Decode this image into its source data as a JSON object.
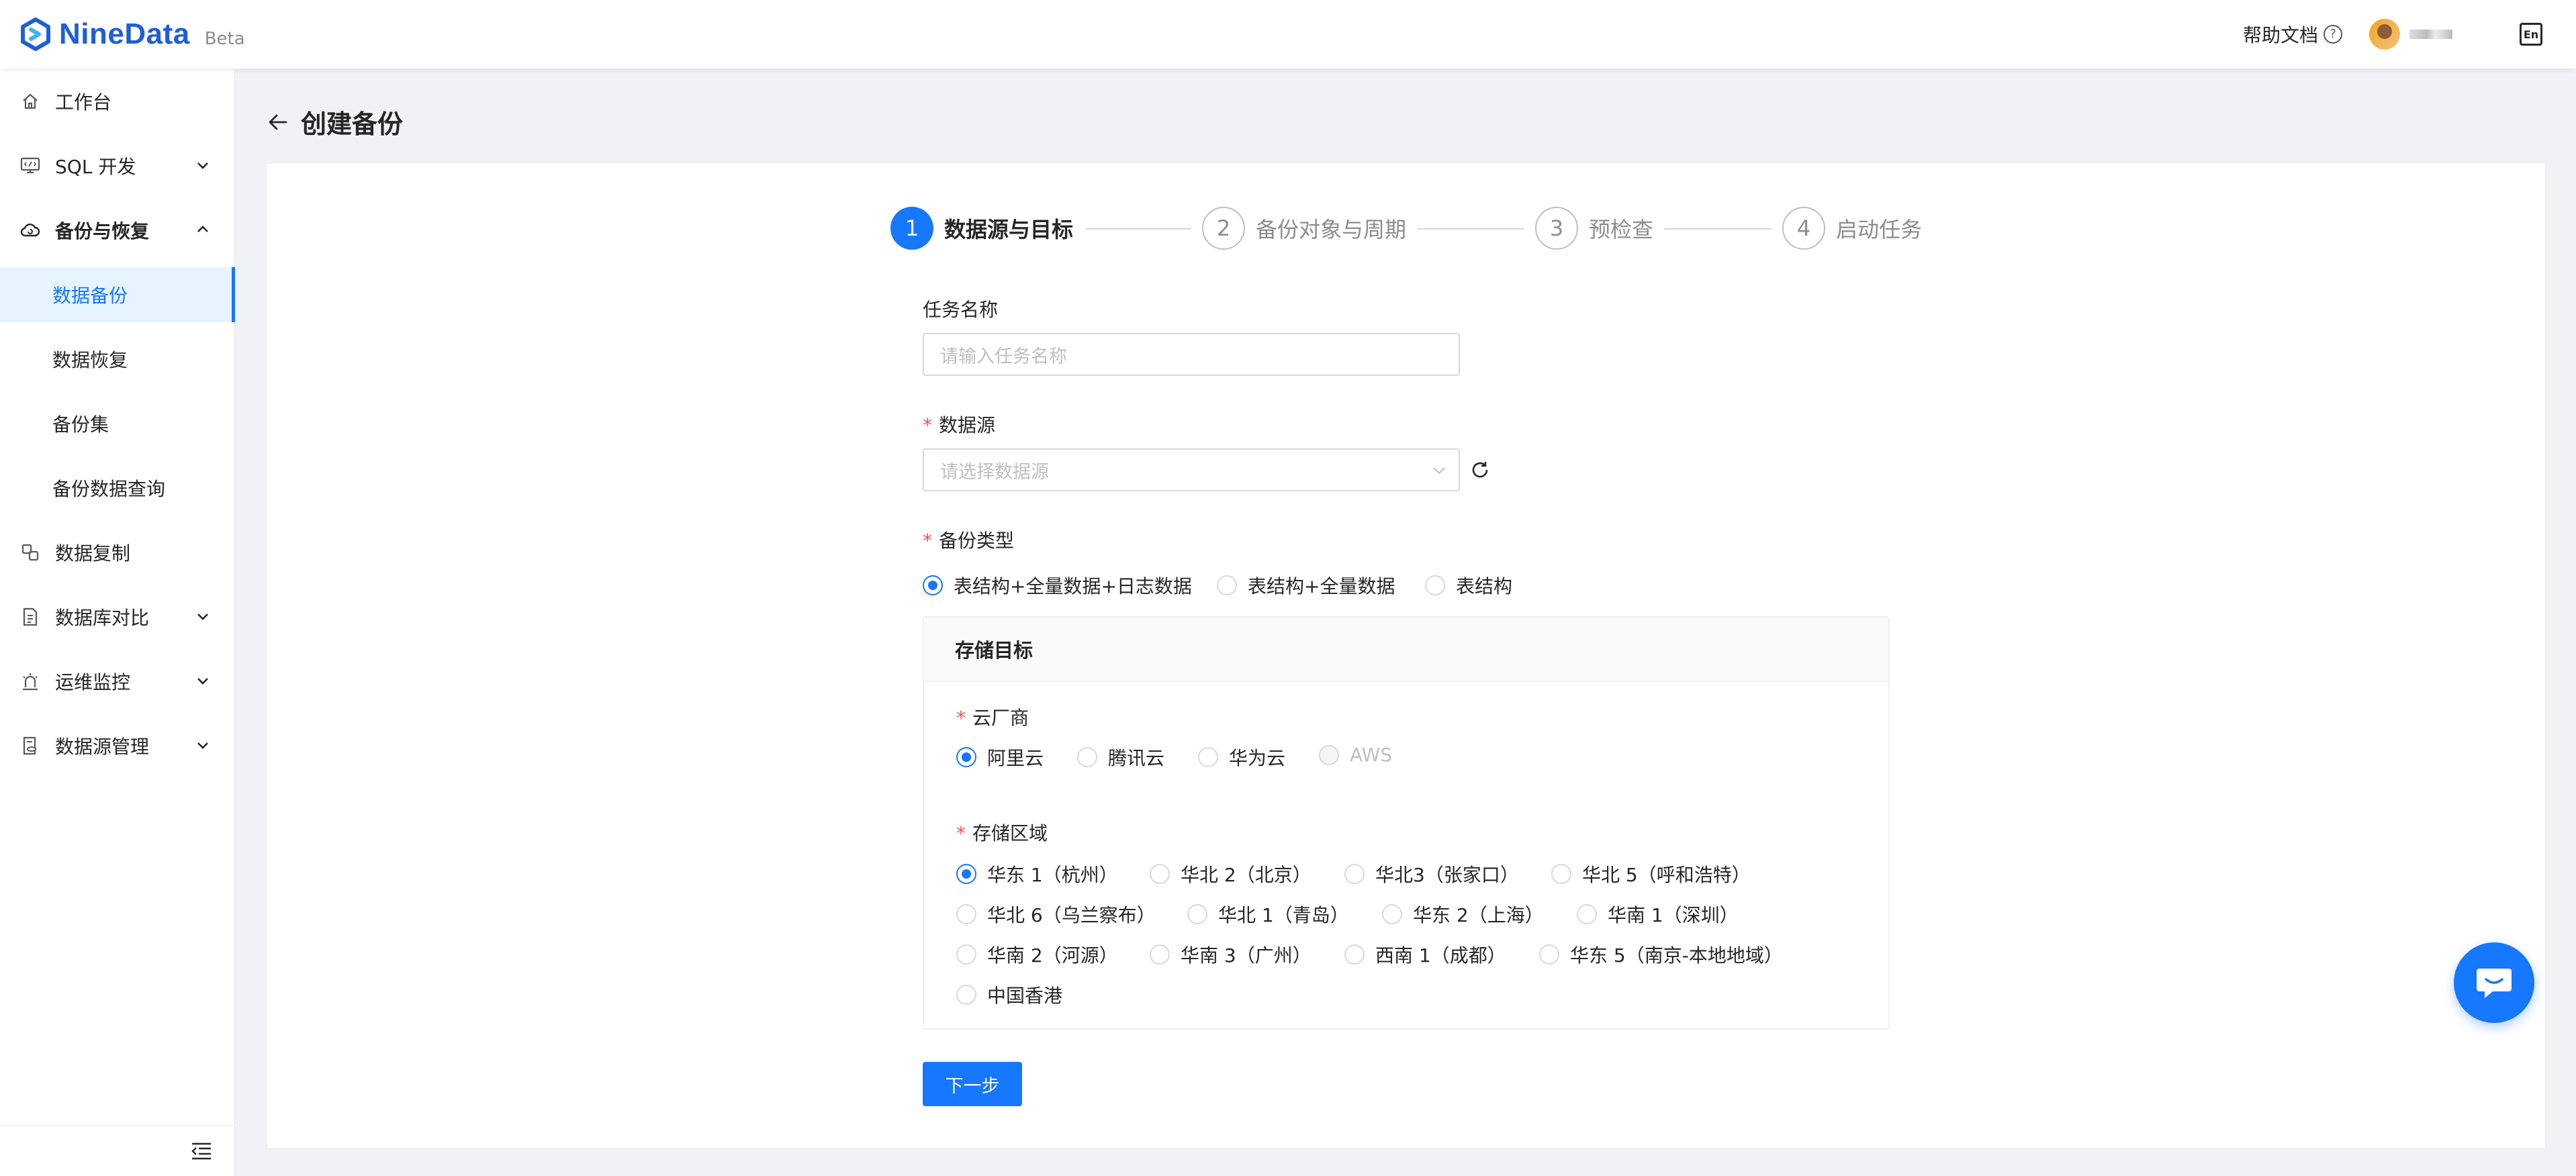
{
  "header": {
    "brand": "NineData",
    "beta": "Beta",
    "help_label": "帮助文档",
    "help_icon": "question-circle-icon",
    "lang_icon": "language-switch-icon"
  },
  "sidebar": {
    "items": [
      {
        "label": "工作台",
        "icon": "home-icon"
      },
      {
        "label": "SQL 开发",
        "icon": "monitor-code-icon"
      },
      {
        "label": "备份与恢复",
        "icon": "cloud-backup-icon"
      },
      {
        "label": "数据复制",
        "icon": "copy-data-icon"
      },
      {
        "label": "数据库对比",
        "icon": "compare-doc-icon"
      },
      {
        "label": "运维监控",
        "icon": "alarm-icon"
      },
      {
        "label": "数据源管理",
        "icon": "datasource-icon"
      }
    ],
    "sub_items": [
      {
        "label": "数据备份"
      },
      {
        "label": "数据恢复"
      },
      {
        "label": "备份集"
      },
      {
        "label": "备份数据查询"
      }
    ]
  },
  "page": {
    "title": "创建备份"
  },
  "steps": [
    {
      "num": "1",
      "label": "数据源与目标"
    },
    {
      "num": "2",
      "label": "备份对象与周期"
    },
    {
      "num": "3",
      "label": "预检查"
    },
    {
      "num": "4",
      "label": "启动任务"
    }
  ],
  "form": {
    "task_name_label": "任务名称",
    "task_name_placeholder": "请输入任务名称",
    "datasource_label": "数据源",
    "datasource_placeholder": "请选择数据源",
    "backup_type_label": "备份类型",
    "backup_types": [
      "表结构+全量数据+日志数据",
      "表结构+全量数据",
      "表结构"
    ],
    "backup_type_selected": "表结构+全量数据+日志数据",
    "storage": {
      "title": "存储目标",
      "cloud_label": "云厂商",
      "clouds": [
        "阿里云",
        "腾讯云",
        "华为云",
        "AWS"
      ],
      "cloud_selected": "阿里云",
      "region_label": "存储区域",
      "regions": [
        "华东 1（杭州）",
        "华北 2（北京）",
        "华北3（张家口）",
        "华北 5（呼和浩特）",
        "华北 6（乌兰察布）",
        "华北 1（青岛）",
        "华东 2（上海）",
        "华南 1（深圳）",
        "华南 2（河源）",
        "华南 3（广州）",
        "西南 1（成都）",
        "华东 5（南京-本地地域）",
        "中国香港"
      ],
      "region_selected": "华东 1（杭州）"
    },
    "next_button": "下一步"
  },
  "colors": {
    "primary": "#1677ff",
    "brand": "#1f5fd6",
    "required": "#ff4d4f"
  }
}
